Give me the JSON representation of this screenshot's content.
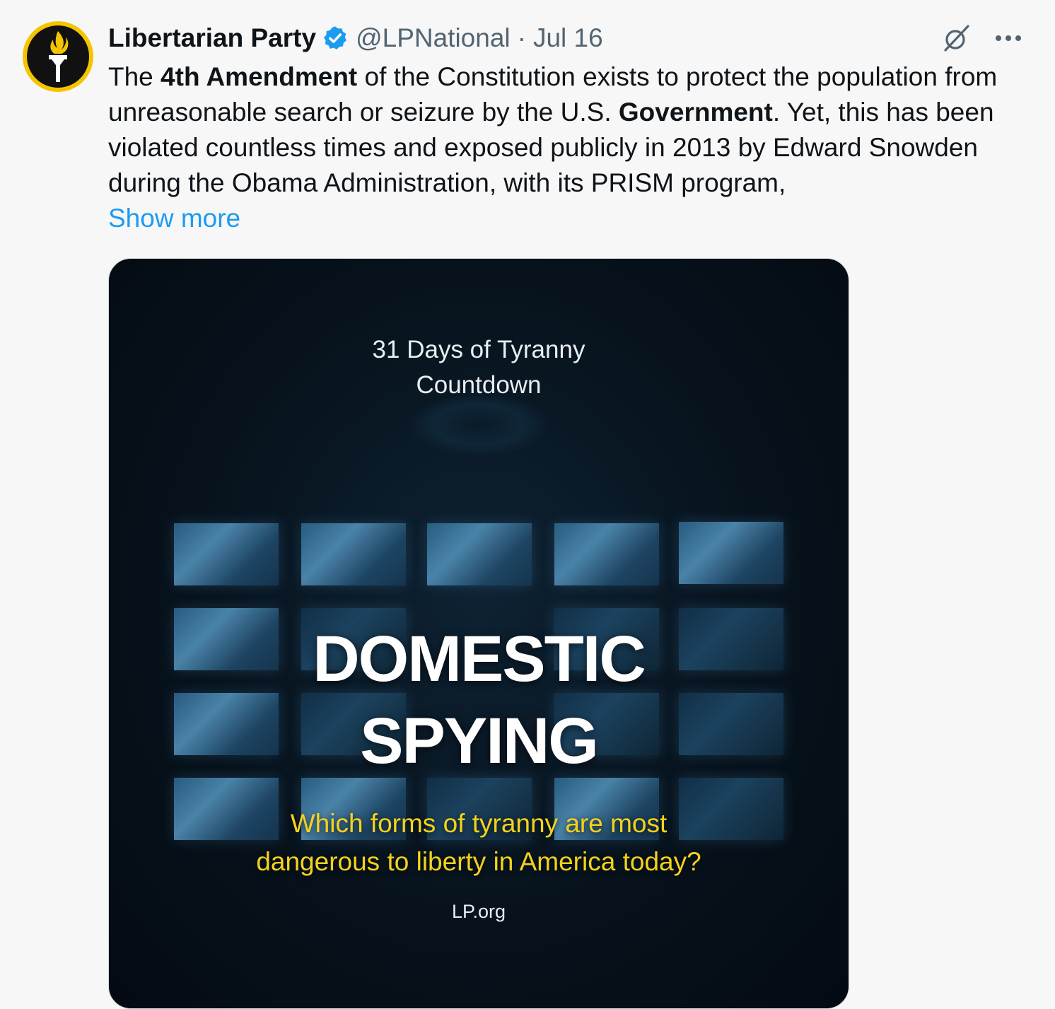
{
  "author": {
    "display_name": "Libertarian Party",
    "handle": "@LPNational",
    "separator": "·",
    "date": "Jul 16",
    "verified": true,
    "avatar_icon": "torch-icon"
  },
  "tweet": {
    "lines": {
      "p1": "The ",
      "b1": "4th Amendment",
      "p2": " of the Constitution exists to protect the population from unreasonable search or seizure by the U.S. ",
      "b2": "Government",
      "p3": ". Yet, this has been violated countless times and exposed publicly in 2013 by Edward Snowden during the Obama Administration, with its PRISM program,"
    },
    "show_more": "Show more"
  },
  "actions": {
    "grok_icon": "grok-icon",
    "more_icon": "more-icon"
  },
  "media": {
    "title_line1": "31 Days of Tyranny",
    "title_line2": "Countdown",
    "headline_line1": "DOMESTIC",
    "headline_line2": "SPYING",
    "question_line1": "Which forms of tyranny are most",
    "question_line2": "dangerous to liberty in America today?",
    "site": "LP.org"
  },
  "colors": {
    "link": "#1d9bf0",
    "verified": "#1d9bf0",
    "question": "#f4d21c",
    "avatar_ring": "#f5c400"
  }
}
